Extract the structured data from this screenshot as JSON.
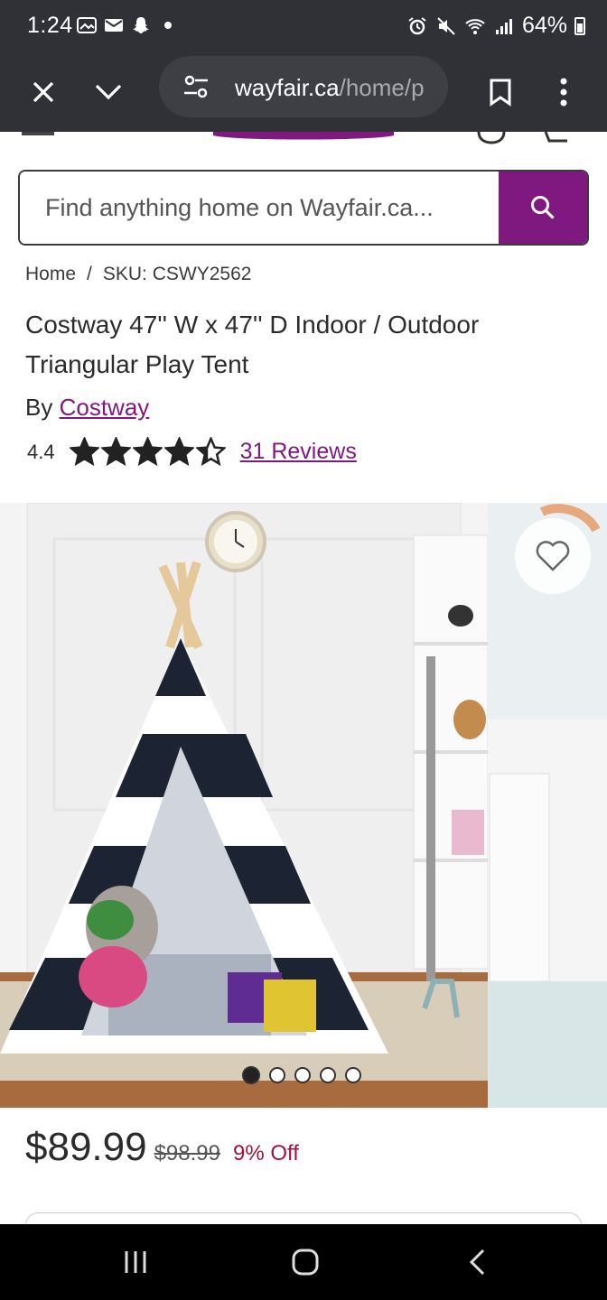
{
  "status_bar": {
    "time": "1:24",
    "battery_percent": "64%",
    "icons": [
      "gallery-icon",
      "mail-icon",
      "snapchat-icon",
      "dot-icon",
      "alarm-icon",
      "mute-icon",
      "wifi-icon",
      "signal-icon",
      "battery-icon"
    ]
  },
  "browser": {
    "url_domain": "wayfair.ca",
    "url_path": "/home/p",
    "icons": [
      "close-icon",
      "chevron-down-icon",
      "site-settings-icon",
      "bookmark-icon",
      "more-vert-icon"
    ]
  },
  "search": {
    "placeholder": "Find anything home on Wayfair.ca..."
  },
  "breadcrumb": {
    "home": "Home",
    "separator": "/",
    "current": "SKU: CSWY2562"
  },
  "product": {
    "title": "Costway 47'' W x 47'' D Indoor / Outdoor Triangular Play Tent",
    "by_prefix": "By",
    "brand": "Costway",
    "rating": "4.4",
    "stars": 4.4,
    "reviews_label": "31 Reviews",
    "image_count": 5,
    "active_image": 1
  },
  "price": {
    "current": "$89.99",
    "original": "$98.99",
    "discount": "9% Off"
  },
  "colors": {
    "brand_purple": "#7f187f",
    "discount_red": "#a3123a",
    "chrome_dark": "#2f3136"
  }
}
